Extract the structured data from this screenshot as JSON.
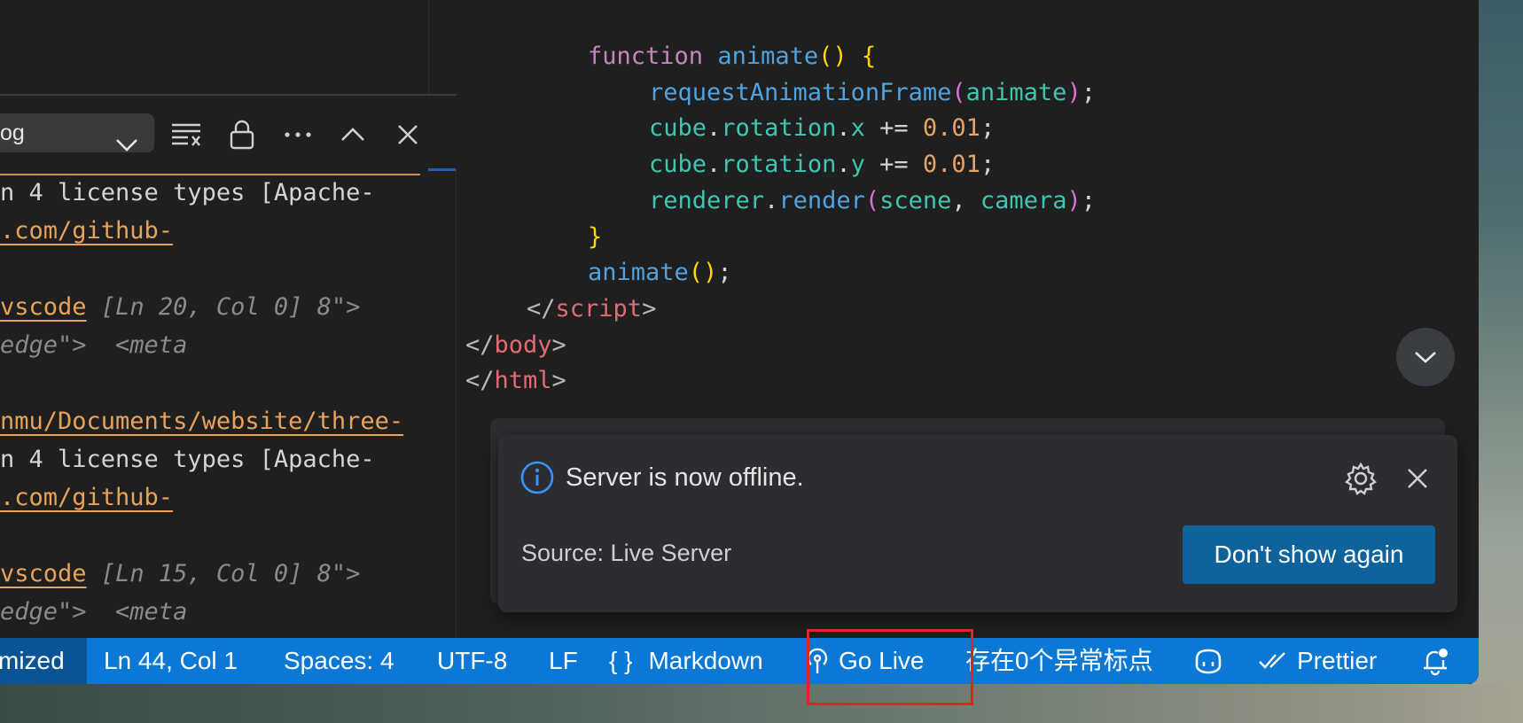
{
  "output_panel": {
    "channel_select": "og",
    "log_lines": [
      {
        "parts": [
          {
            "t": "plain",
            "v": "n 4 license types [Apache-"
          }
        ]
      },
      {
        "parts": [
          {
            "t": "link",
            "v": ".com/github-"
          }
        ]
      },
      {
        "parts": [
          {
            "t": "link",
            "v": "vscode"
          },
          {
            "t": "plain",
            "v": " "
          },
          {
            "t": "ital",
            "v": "[Ln 20, Col 0] 8\">"
          }
        ]
      },
      {
        "parts": [
          {
            "t": "ital",
            "v": "edge\">  <meta"
          }
        ]
      },
      {
        "parts": [
          {
            "t": "link",
            "v": "nmu/Documents/website/three-"
          }
        ]
      },
      {
        "parts": [
          {
            "t": "plain",
            "v": "n 4 license types [Apache-"
          }
        ]
      },
      {
        "parts": [
          {
            "t": "link",
            "v": ".com/github-"
          }
        ]
      },
      {
        "parts": [
          {
            "t": "link",
            "v": "vscode"
          },
          {
            "t": "plain",
            "v": " "
          },
          {
            "t": "ital",
            "v": "[Ln 15, Col 0] 8\">"
          }
        ]
      },
      {
        "parts": [
          {
            "t": "ital",
            "v": "edge\">  <meta"
          }
        ]
      }
    ]
  },
  "editor": {
    "code_lines": [
      {
        "indent": 2,
        "parts": [
          {
            "c": "kw",
            "v": "function"
          },
          {
            "c": "pun",
            "v": " "
          },
          {
            "c": "fn",
            "v": "animate"
          },
          {
            "c": "br1",
            "v": "()"
          },
          {
            "c": "pun",
            "v": " "
          },
          {
            "c": "br1",
            "v": "{"
          }
        ]
      },
      {
        "indent": 3,
        "parts": [
          {
            "c": "fn",
            "v": "requestAnimationFrame"
          },
          {
            "c": "br2",
            "v": "("
          },
          {
            "c": "var",
            "v": "animate"
          },
          {
            "c": "br2",
            "v": ")"
          },
          {
            "c": "pun",
            "v": ";"
          }
        ]
      },
      {
        "indent": 3,
        "parts": [
          {
            "c": "var",
            "v": "cube"
          },
          {
            "c": "pun",
            "v": "."
          },
          {
            "c": "var",
            "v": "rotation"
          },
          {
            "c": "pun",
            "v": "."
          },
          {
            "c": "var",
            "v": "x"
          },
          {
            "c": "pun",
            "v": " += "
          },
          {
            "c": "num",
            "v": "0.01"
          },
          {
            "c": "pun",
            "v": ";"
          }
        ]
      },
      {
        "indent": 3,
        "parts": [
          {
            "c": "var",
            "v": "cube"
          },
          {
            "c": "pun",
            "v": "."
          },
          {
            "c": "var",
            "v": "rotation"
          },
          {
            "c": "pun",
            "v": "."
          },
          {
            "c": "var",
            "v": "y"
          },
          {
            "c": "pun",
            "v": " += "
          },
          {
            "c": "num",
            "v": "0.01"
          },
          {
            "c": "pun",
            "v": ";"
          }
        ]
      },
      {
        "indent": 3,
        "parts": [
          {
            "c": "var",
            "v": "renderer"
          },
          {
            "c": "pun",
            "v": "."
          },
          {
            "c": "fn",
            "v": "render"
          },
          {
            "c": "br2",
            "v": "("
          },
          {
            "c": "var",
            "v": "scene"
          },
          {
            "c": "pun",
            "v": ", "
          },
          {
            "c": "var",
            "v": "camera"
          },
          {
            "c": "br2",
            "v": ")"
          },
          {
            "c": "pun",
            "v": ";"
          }
        ]
      },
      {
        "indent": 2,
        "parts": [
          {
            "c": "br1",
            "v": "}"
          }
        ]
      },
      {
        "indent": 2,
        "parts": [
          {
            "c": "fn",
            "v": "animate"
          },
          {
            "c": "br1",
            "v": "()"
          },
          {
            "c": "pun",
            "v": ";"
          }
        ]
      },
      {
        "indent": 1,
        "parts": [
          {
            "c": "ang",
            "v": "</"
          },
          {
            "c": "tag",
            "v": "script"
          },
          {
            "c": "ang",
            "v": ">"
          }
        ]
      },
      {
        "indent": 0,
        "parts": [
          {
            "c": "ang",
            "v": "</"
          },
          {
            "c": "tag",
            "v": "body"
          },
          {
            "c": "ang",
            "v": ">"
          }
        ]
      },
      {
        "indent": 0,
        "parts": [
          {
            "c": "ang",
            "v": "</"
          },
          {
            "c": "tag",
            "v": "html"
          },
          {
            "c": "ang",
            "v": ">"
          }
        ]
      }
    ]
  },
  "notification": {
    "message": "Server is now offline.",
    "source": "Source: Live Server",
    "action_button": "Don't show again"
  },
  "statusbar": {
    "left_fragment": "mized",
    "position": "Ln 44, Col 1",
    "spaces": "Spaces: 4",
    "encoding": "UTF-8",
    "eol": "LF",
    "language_braces": "{ }",
    "language": "Markdown",
    "go_live": "Go Live",
    "punctuation_check": "存在0个异常标点",
    "prettier": "Prettier"
  },
  "colors": {
    "statusbar_bg": "#0a78d4",
    "button_bg": "#0e639c",
    "highlight_box": "#e02424"
  }
}
